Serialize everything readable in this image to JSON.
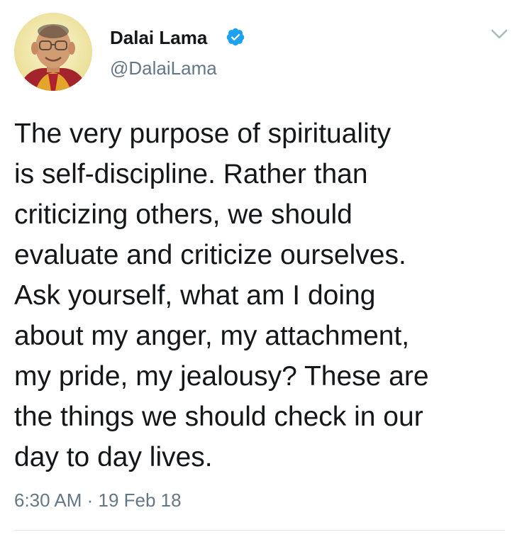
{
  "tweet": {
    "author": {
      "name": "Dalai Lama",
      "handle": "@DalaiLama",
      "verified": true
    },
    "text": "The very purpose of spirituality\nis self-discipline. Rather than\ncriticizing others, we should\nevaluate and criticize ourselves.\nAsk yourself, what am I doing\nabout my anger, my attachment,\nmy pride, my jealousy? These are\nthe things we should check in our\nday to day lives.",
    "timestamp": "6:30 AM · 19 Feb 18"
  },
  "icons": {
    "verified": "verified-badge-icon",
    "menu": "chevron-down-icon"
  },
  "colors": {
    "text": "#14171a",
    "secondary": "#657786",
    "verified": "#1da1f2",
    "divider": "#e1e8ed"
  }
}
